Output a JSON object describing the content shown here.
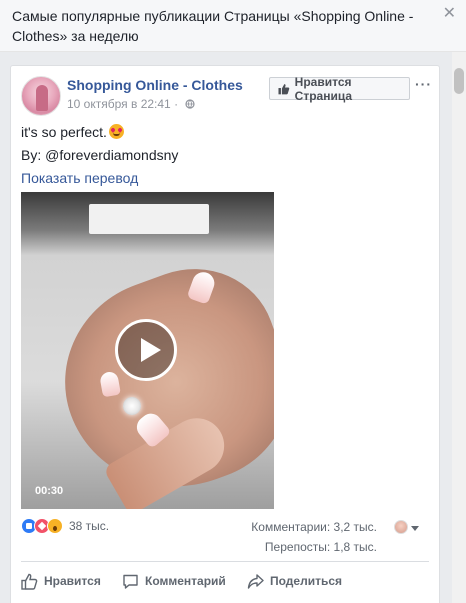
{
  "dialog": {
    "title": "Самые популярные публикации Страницы «Shopping Online - Clothes» за неделю",
    "close_glyph": "✕"
  },
  "post": {
    "page_name": "Shopping Online - Clothes",
    "time": "10 октября в 22:41",
    "privacy_separator": "·",
    "like_page_button": "Нравится Страница",
    "more_glyph": "···",
    "text": "it's so perfect.",
    "by_line": "By: @foreverdiamondsny",
    "translate_link": "Показать перевод",
    "video": {
      "duration": "00:30"
    },
    "stats": {
      "reactions_count": "38 тыс.",
      "comments": "Комментарии: 3,2 тыс.",
      "shares": "Перепосты: 1,8 тыс."
    },
    "actions": {
      "like": "Нравится",
      "comment": "Комментарий",
      "share": "Поделиться"
    }
  },
  "icons": {
    "close": "close-icon",
    "globe": "globe-icon",
    "thumb": "thumbs-up-icon",
    "more": "more-icon",
    "play": "play-icon",
    "reactions": [
      "like-reaction-icon",
      "love-reaction-icon",
      "wow-reaction-icon"
    ],
    "comment": "comment-icon",
    "share": "share-icon",
    "caret": "caret-down-icon"
  },
  "colors": {
    "link": "#365899",
    "background": "#e9ebee",
    "like_reaction": "#2e7bf6",
    "love_reaction": "#f25268",
    "wow_reaction": "#f7b125"
  }
}
